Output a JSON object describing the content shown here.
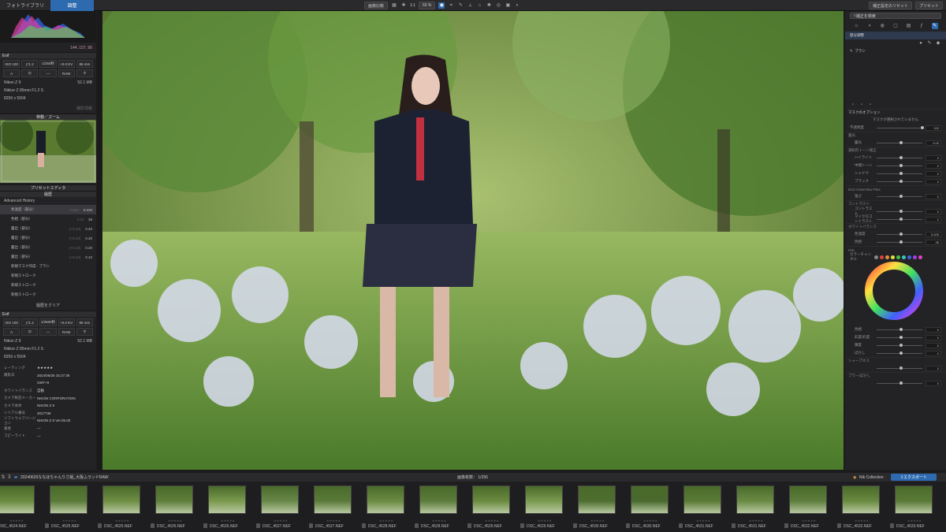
{
  "topbar": {
    "tab_library": "フォトライブラリ",
    "tab_edit": "調整",
    "compare": "画像比較",
    "ratio": "1:1",
    "zoom": "60 %",
    "reset": "補正設定のリセット",
    "presets": "プリセット"
  },
  "histogram": {
    "rgb": "144, 157, 96"
  },
  "exif1": {
    "title": "Exif",
    "iso": "ISO 100",
    "f": "ƒ/1.2",
    "shutter": "1/250秒",
    "ev": "+0.0 EV",
    "focal": "85 mm",
    "a": "A",
    "dash": "—",
    "raw": "RAW",
    "camera": "Nikon Z 9",
    "size": "52.1 MB",
    "lens": "Nikkor Z 85mm F1.2 S",
    "dims": "8256 x 5504",
    "more": "撮影情報"
  },
  "nav": {
    "title": "移動／ズーム"
  },
  "preset_editor": {
    "title": "プリセットエディタ"
  },
  "history": {
    "title": "履歴",
    "sub": "Advanced History",
    "clear": "履歴をクリア",
    "items": [
      {
        "label": "色温度（部分）",
        "v1": "+1293",
        "v2": "5,628"
      },
      {
        "label": "色相（部分）",
        "v1": "(+0)",
        "v2": "36"
      },
      {
        "label": "露出（部分）",
        "v1": "(+0.10)",
        "v2": "0.40"
      },
      {
        "label": "露出（部分）",
        "v1": "(+0.10)",
        "v2": "0.30"
      },
      {
        "label": "露出（部分）",
        "v1": "(+0.10)",
        "v2": "0.20"
      },
      {
        "label": "露出（部分）",
        "v1": "(+0.10)",
        "v2": "0.10"
      },
      {
        "label": "新規マスク作成 - ブラシ",
        "v1": "",
        "v2": ""
      },
      {
        "label": "新規ストローク",
        "v1": "",
        "v2": ""
      },
      {
        "label": "新規ストローク",
        "v1": "",
        "v2": ""
      },
      {
        "label": "新規ストローク",
        "v1": "",
        "v2": ""
      }
    ]
  },
  "exif2": {
    "title": "Exif",
    "iso": "ISO 100",
    "f": "ƒ/1.2",
    "shutter": "1/2500秒",
    "ev": "+0.0 EV",
    "focal": "85 mm",
    "a": "A",
    "dash": "—",
    "raw": "RAW",
    "camera": "Nikon Z 9",
    "size": "52.1 MB",
    "lens": "Nikkor Z 85mm F1.2 S",
    "dims": "8256 x 5504"
  },
  "meta": [
    {
      "k": "レーティング",
      "v": "★★★★★"
    },
    {
      "k": "撮影日",
      "v": "2024/06/26 15:27:39"
    },
    {
      "k": "",
      "v": "GMT+9"
    },
    {
      "k": "ホワイトバランス",
      "v": "自動"
    },
    {
      "k": "カメラ製造メーカー",
      "v": "NIKON CORPORATION"
    },
    {
      "k": "カメラ本体",
      "v": "NIKON Z 9"
    },
    {
      "k": "シリアル番号",
      "v": "3017736"
    },
    {
      "k": "ソフトウェアバージョン",
      "v": "NIKON Z 9 Ver.05.00"
    },
    {
      "k": "著者",
      "v": "—"
    },
    {
      "k": "コピーライト",
      "v": "—"
    }
  ],
  "right": {
    "search": "補正を検索",
    "local": "部分調整",
    "brush": "ブラシ",
    "mask_options": "マスクのオプション",
    "mask_none": "マスクが選択されていません",
    "opacity": "不透明度",
    "opacity_v": "100",
    "sections": [
      {
        "t": "露光",
        "rows": [
          [
            "露光",
            "0.00"
          ]
        ]
      },
      {
        "t": "選択的トーン補正",
        "rows": [
          [
            "ハイライト",
            "0"
          ],
          [
            "中間トーン",
            "0"
          ],
          [
            "シャドウ",
            "0"
          ],
          [
            "ブラック",
            "0"
          ]
        ]
      },
      {
        "t": "DxO ClearView Plus",
        "rows": [
          [
            "強さ",
            "0"
          ]
        ]
      },
      {
        "t": "コントラスト",
        "rows": [
          [
            "コントラスト",
            "0"
          ],
          [
            "マイクロコントラスト",
            "0"
          ]
        ]
      },
      {
        "t": "ホワイトバランス",
        "rows": [
          [
            "色温度",
            "5,628"
          ],
          [
            "色相",
            "36"
          ]
        ]
      },
      {
        "t": "HSL",
        "rows": [
          [
            "カラーチャンネル",
            ""
          ]
        ]
      }
    ],
    "hsl_rows": [
      [
        "色相",
        "0"
      ],
      [
        "彩度/彩度",
        "0"
      ],
      [
        "輝度",
        "0"
      ],
      [
        "ぼかし",
        "0"
      ]
    ],
    "sharp": "シャープネス",
    "sharp_v": "0",
    "blur": "ブラー/ぼかし",
    "blur_v": "0"
  },
  "filmstrip": {
    "path": "20240626ななほちゃんりさ組_大阪ふランドRAW",
    "count": "画像枚数：",
    "count_v": "1/256",
    "nik": "Nik Collection",
    "export": "エクスポート",
    "thumbs": [
      "DSC_4524.NEF",
      "DSC_4525.NEF",
      "DSC_4525.NEF",
      "DSC_4526.NEF",
      "DSC_4526.NEF",
      "DSC_4527.NEF",
      "DSC_4527.NEF",
      "DSC_4528.NEF",
      "DSC_4528.NEF",
      "DSC_4529.NEF",
      "DSC_4529.NEF",
      "DSC_4530.NEF",
      "DSC_4530.NEF",
      "DSC_4531.NEF",
      "DSC_4531.NEF",
      "DSC_4532.NEF",
      "DSC_4532.NEF",
      "DSC_4533.NEF"
    ]
  },
  "colors": {
    "accent": "#2d6ab0",
    "rgb_r": "#e05050",
    "rgb_g": "#50c050",
    "rgb_b": "#5070e0"
  }
}
